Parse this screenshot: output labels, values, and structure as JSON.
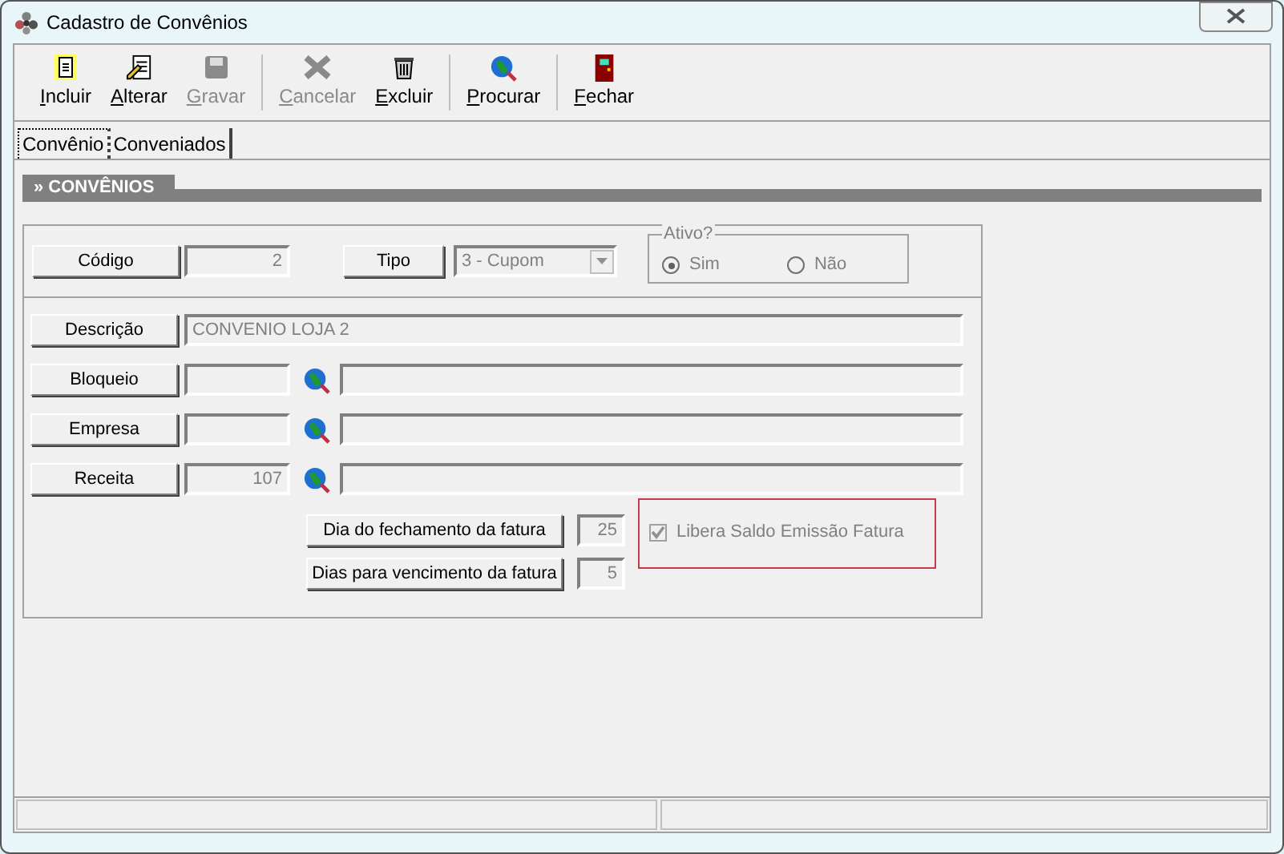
{
  "window": {
    "title": "Cadastro de Convênios"
  },
  "toolbar": [
    {
      "items": [
        {
          "label": "Incluir",
          "kind": "new",
          "disabled": false
        },
        {
          "label": "Alterar",
          "kind": "edit",
          "disabled": false
        },
        {
          "label": "Gravar",
          "kind": "save",
          "disabled": true
        }
      ]
    },
    {
      "items": [
        {
          "label": "Cancelar",
          "kind": "cancel",
          "disabled": true
        },
        {
          "label": "Excluir",
          "kind": "delete",
          "disabled": false
        }
      ]
    },
    {
      "items": [
        {
          "label": "Procurar",
          "kind": "search",
          "disabled": false
        }
      ]
    },
    {
      "items": [
        {
          "label": "Fechar",
          "kind": "exit",
          "disabled": false
        }
      ]
    }
  ],
  "tabs": [
    {
      "label": "Convênio",
      "selected": true
    },
    {
      "label": "Conveniados",
      "selected": false
    }
  ],
  "section": {
    "title": "» CONVÊNIOS"
  },
  "codigo": {
    "label": "Código",
    "value": "2"
  },
  "tipo": {
    "label": "Tipo",
    "value": "3 - Cupom"
  },
  "ativo": {
    "legend": "Ativo?",
    "options": [
      {
        "label": "Sim",
        "selected": true
      },
      {
        "label": "Não",
        "selected": false
      }
    ]
  },
  "rows": [
    {
      "kind": "text",
      "label": "Descrição",
      "value": "CONVENIO LOJA 2"
    },
    {
      "kind": "lookup",
      "label": "Bloqueio",
      "code": ""
    },
    {
      "kind": "lookup",
      "label": "Empresa",
      "code": ""
    },
    {
      "kind": "lookup",
      "label": "Receita",
      "code": "107"
    }
  ],
  "fatura": [
    {
      "label": "Dia do fechamento da fatura",
      "value": "25"
    },
    {
      "label": "Dias para vencimento da fatura",
      "value": "5"
    }
  ],
  "libera": {
    "label": "Libera Saldo Emissão Fatura",
    "checked": true,
    "disabled": true
  }
}
